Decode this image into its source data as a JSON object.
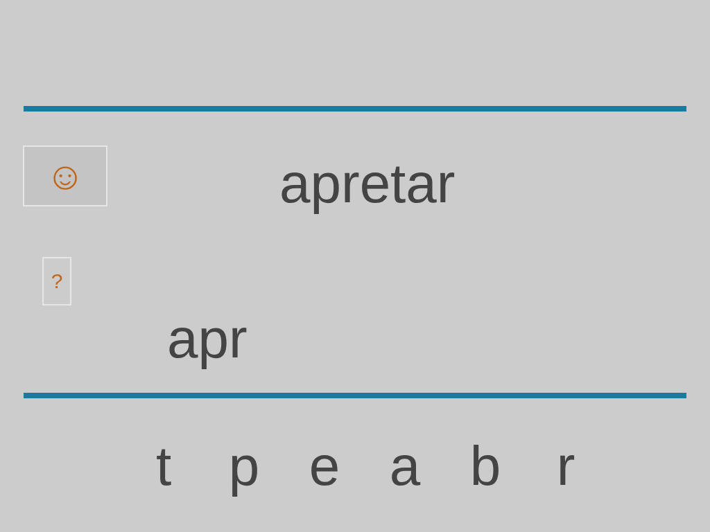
{
  "word": "apretar",
  "hint_button": {
    "label": "☺"
  },
  "help_button": {
    "label": "?"
  },
  "answer": "apr",
  "letters": [
    {
      "label": "t"
    },
    {
      "label": "p"
    },
    {
      "label": "e"
    },
    {
      "label": "a"
    },
    {
      "label": "b"
    },
    {
      "label": "r"
    }
  ]
}
